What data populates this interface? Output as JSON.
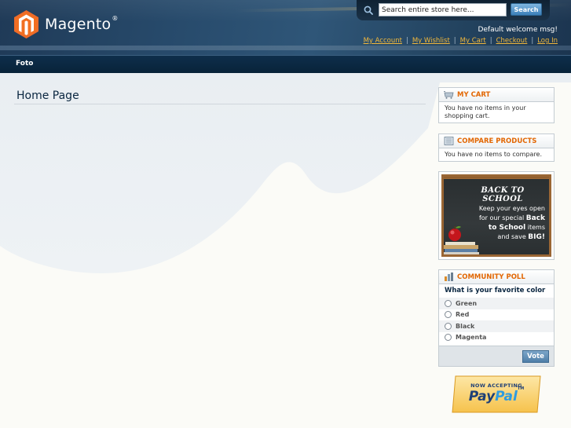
{
  "header": {
    "logo_text": "Magento",
    "logo_mark": "®",
    "search": {
      "placeholder": "Search entire store here...",
      "button_label": "Search"
    },
    "welcome": "Default welcome msg!",
    "links": [
      "My Account",
      "My Wishlist",
      "My Cart",
      "Checkout",
      "Log In"
    ],
    "separator": "|"
  },
  "nav": {
    "items": [
      "Foto"
    ]
  },
  "main": {
    "page_title": "Home Page"
  },
  "sidebar": {
    "cart": {
      "title": "My Cart",
      "text": "You have no items in your shopping cart."
    },
    "compare": {
      "title": "Compare Products",
      "text": "You have no items to compare."
    },
    "banner": {
      "title": "BACK TO SCHOOL",
      "line1": "Keep your eyes open",
      "line2_a": "for our special ",
      "line2_b": "Back",
      "line3_a": "to School",
      "line3_b": " items",
      "line4_a": "and save ",
      "line4_b": "BIG!"
    },
    "poll": {
      "title": "Community Poll",
      "question": "What is your favorite color",
      "options": [
        "Green",
        "Red",
        "Black",
        "Magenta"
      ],
      "vote_label": "Vote"
    },
    "paypal": {
      "top": "NOW ACCEPTING",
      "word_pay": "Pay",
      "word_pal": "Pal",
      "tm": "TM"
    }
  },
  "colors": {
    "accent_orange": "#e26703",
    "link_gold": "#f2b83c",
    "header_blue": "#274a6b",
    "nav_blue": "#0e2e4b"
  }
}
